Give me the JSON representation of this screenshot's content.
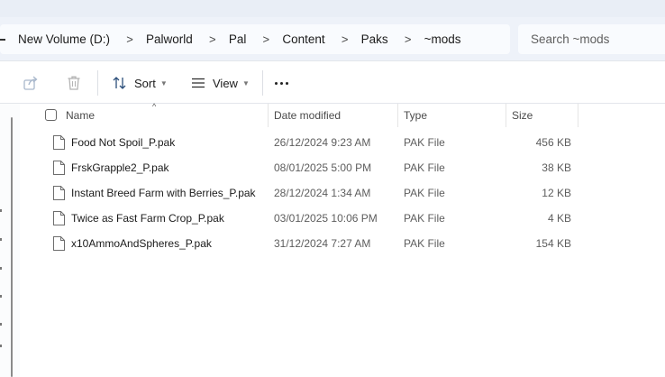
{
  "breadcrumb": {
    "items": [
      "New Volume (D:)",
      "Palworld",
      "Pal",
      "Content",
      "Paks",
      "~mods"
    ],
    "separator": ">"
  },
  "search": {
    "placeholder": "Search ~mods"
  },
  "toolbar": {
    "share_icon": "share-icon",
    "delete_icon": "trash-icon",
    "sort_label": "Sort",
    "view_label": "View",
    "more_icon": "more-horizontal-icon"
  },
  "columns": {
    "name": "Name",
    "date_modified": "Date modified",
    "type": "Type",
    "size": "Size"
  },
  "files": [
    {
      "name": "Food Not Spoil_P.pak",
      "date": "26/12/2024 9:23 AM",
      "type": "PAK File",
      "size": "456 KB"
    },
    {
      "name": "FrskGrapple2_P.pak",
      "date": "08/01/2025 5:00 PM",
      "type": "PAK File",
      "size": "38 KB"
    },
    {
      "name": "Instant Breed Farm with Berries_P.pak",
      "date": "28/12/2024 1:34 AM",
      "type": "PAK File",
      "size": "12 KB"
    },
    {
      "name": "Twice as Fast Farm Crop_P.pak",
      "date": "03/01/2025 10:06 PM",
      "type": "PAK File",
      "size": "4 KB"
    },
    {
      "name": "x10AmmoAndSpheres_P.pak",
      "date": "31/12/2024 7:27 AM",
      "type": "PAK File",
      "size": "154 KB"
    }
  ],
  "colors": {
    "address_bar_bg": "#eef2f9",
    "accent": "#0067c0",
    "disabled_icon": "#a9b8cc"
  }
}
